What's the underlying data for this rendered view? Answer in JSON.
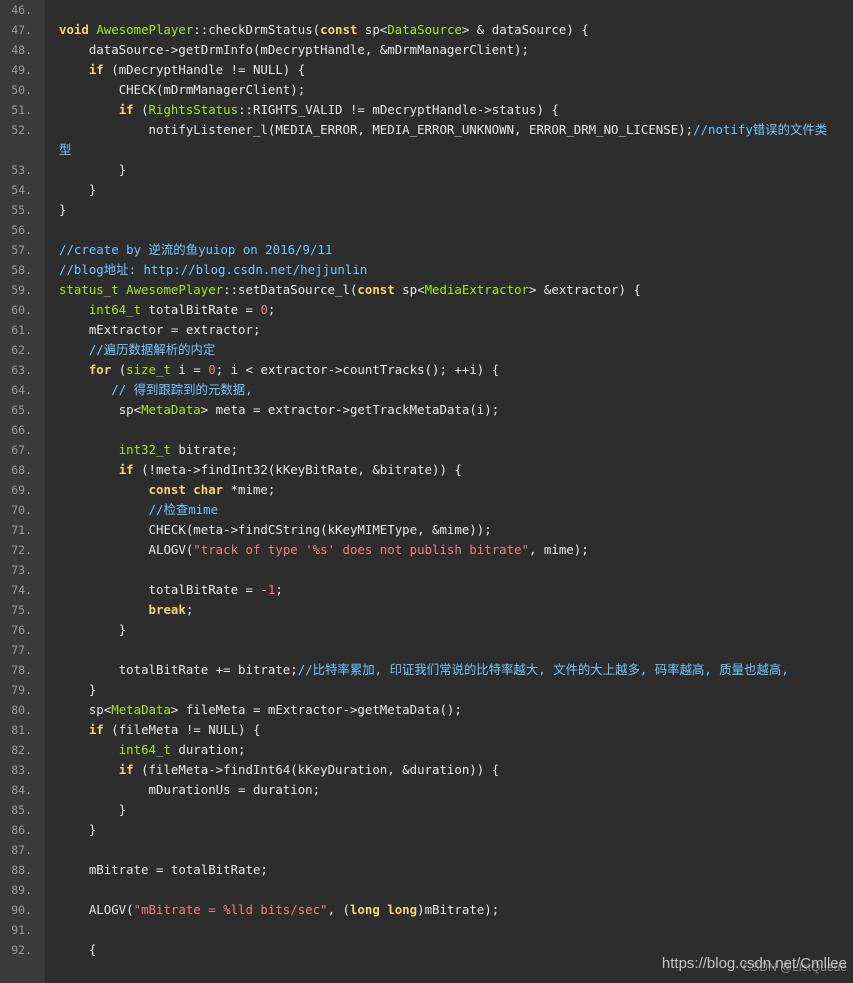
{
  "lines": [
    {
      "num": "46.",
      "tokens": []
    },
    {
      "num": "47.",
      "tokens": [
        [
          "k",
          "void "
        ],
        [
          "t",
          "AwesomePlayer"
        ],
        [
          "p",
          "::checkDrmStatus("
        ],
        [
          "k",
          "const "
        ],
        [
          "p",
          "sp<"
        ],
        [
          "t",
          "DataSource"
        ],
        [
          "p",
          "> & dataSource) {"
        ]
      ]
    },
    {
      "num": "48.",
      "tokens": [
        [
          "p",
          "    dataSource->getDrmInfo(mDecryptHandle, &mDrmManagerClient);"
        ]
      ]
    },
    {
      "num": "49.",
      "tokens": [
        [
          "p",
          "    "
        ],
        [
          "k",
          "if "
        ],
        [
          "p",
          "(mDecryptHandle != NULL) {"
        ]
      ]
    },
    {
      "num": "50.",
      "tokens": [
        [
          "p",
          "        CHECK(mDrmManagerClient);"
        ]
      ]
    },
    {
      "num": "51.",
      "tokens": [
        [
          "p",
          "        "
        ],
        [
          "k",
          "if "
        ],
        [
          "p",
          "("
        ],
        [
          "t",
          "RightsStatus"
        ],
        [
          "p",
          "::RIGHTS_VALID != mDecryptHandle->status) {"
        ]
      ]
    },
    {
      "num": "52.",
      "tokens": [
        [
          "p",
          "            notifyListener_l(MEDIA_ERROR, MEDIA_ERROR_UNKNOWN, ERROR_DRM_NO_LICENSE);"
        ],
        [
          "c",
          "//notify错误的文件类型"
        ]
      ]
    },
    {
      "num": "53.",
      "tokens": [
        [
          "p",
          "        }"
        ]
      ]
    },
    {
      "num": "54.",
      "tokens": [
        [
          "p",
          "    }"
        ]
      ]
    },
    {
      "num": "55.",
      "tokens": [
        [
          "p",
          "}"
        ]
      ]
    },
    {
      "num": "56.",
      "tokens": []
    },
    {
      "num": "57.",
      "tokens": [
        [
          "c",
          "//create by 逆流的鱼yuiop on 2016/9/11"
        ]
      ]
    },
    {
      "num": "58.",
      "tokens": [
        [
          "c",
          "//blog地址: http://blog.csdn.net/hejjunlin"
        ]
      ]
    },
    {
      "num": "59.",
      "tokens": [
        [
          "t",
          "status_t "
        ],
        [
          "t",
          "AwesomePlayer"
        ],
        [
          "p",
          "::setDataSource_l("
        ],
        [
          "k",
          "const "
        ],
        [
          "p",
          "sp<"
        ],
        [
          "t",
          "MediaExtractor"
        ],
        [
          "p",
          "> &extractor) {"
        ]
      ]
    },
    {
      "num": "60.",
      "tokens": [
        [
          "p",
          "    "
        ],
        [
          "t",
          "int64_t "
        ],
        [
          "p",
          "totalBitRate = "
        ],
        [
          "n",
          "0"
        ],
        [
          "p",
          ";"
        ]
      ]
    },
    {
      "num": "61.",
      "tokens": [
        [
          "p",
          "    mExtractor = extractor;"
        ]
      ]
    },
    {
      "num": "62.",
      "tokens": [
        [
          "p",
          "    "
        ],
        [
          "c",
          "//遍历数据解析的内定"
        ]
      ]
    },
    {
      "num": "63.",
      "tokens": [
        [
          "p",
          "    "
        ],
        [
          "k",
          "for "
        ],
        [
          "p",
          "("
        ],
        [
          "t",
          "size_t "
        ],
        [
          "p",
          "i = "
        ],
        [
          "n",
          "0"
        ],
        [
          "p",
          "; i < extractor->countTracks(); ++i) {"
        ]
      ]
    },
    {
      "num": "64.",
      "tokens": [
        [
          "p",
          "       "
        ],
        [
          "c",
          "// 得到跟踪到的元数据,"
        ]
      ]
    },
    {
      "num": "65.",
      "tokens": [
        [
          "p",
          "        sp<"
        ],
        [
          "t",
          "MetaData"
        ],
        [
          "p",
          "> meta = extractor->getTrackMetaData(i);"
        ]
      ]
    },
    {
      "num": "66.",
      "tokens": []
    },
    {
      "num": "67.",
      "tokens": [
        [
          "p",
          "        "
        ],
        [
          "t",
          "int32_t "
        ],
        [
          "p",
          "bitrate;"
        ]
      ]
    },
    {
      "num": "68.",
      "tokens": [
        [
          "p",
          "        "
        ],
        [
          "k",
          "if "
        ],
        [
          "p",
          "(!meta->findInt32(kKeyBitRate, &bitrate)) {"
        ]
      ]
    },
    {
      "num": "69.",
      "tokens": [
        [
          "p",
          "            "
        ],
        [
          "k",
          "const char "
        ],
        [
          "p",
          "*mime;"
        ]
      ]
    },
    {
      "num": "70.",
      "tokens": [
        [
          "p",
          "            "
        ],
        [
          "c",
          "//检查mime"
        ]
      ]
    },
    {
      "num": "71.",
      "tokens": [
        [
          "p",
          "            CHECK(meta->findCString(kKeyMIMEType, &mime));"
        ]
      ]
    },
    {
      "num": "72.",
      "tokens": [
        [
          "p",
          "            ALOGV("
        ],
        [
          "s",
          "\"track of type '%s' does not publish bitrate\""
        ],
        [
          "p",
          ", mime);"
        ]
      ]
    },
    {
      "num": "73.",
      "tokens": []
    },
    {
      "num": "74.",
      "tokens": [
        [
          "p",
          "            totalBitRate = -"
        ],
        [
          "n",
          "1"
        ],
        [
          "p",
          ";"
        ]
      ]
    },
    {
      "num": "75.",
      "tokens": [
        [
          "p",
          "            "
        ],
        [
          "k",
          "break"
        ],
        [
          "p",
          ";"
        ]
      ]
    },
    {
      "num": "76.",
      "tokens": [
        [
          "p",
          "        }"
        ]
      ]
    },
    {
      "num": "77.",
      "tokens": []
    },
    {
      "num": "78.",
      "tokens": [
        [
          "p",
          "        totalBitRate += bitrate;"
        ],
        [
          "c",
          "//比特率累加, 印证我们常说的比特率越大, 文件的大上越多, 码率越高, 质量也越高,"
        ]
      ]
    },
    {
      "num": "79.",
      "tokens": [
        [
          "p",
          "    }"
        ]
      ]
    },
    {
      "num": "80.",
      "tokens": [
        [
          "p",
          "    sp<"
        ],
        [
          "t",
          "MetaData"
        ],
        [
          "p",
          "> fileMeta = mExtractor->getMetaData();"
        ]
      ]
    },
    {
      "num": "81.",
      "tokens": [
        [
          "p",
          "    "
        ],
        [
          "k",
          "if "
        ],
        [
          "p",
          "(fileMeta != NULL) {"
        ]
      ]
    },
    {
      "num": "82.",
      "tokens": [
        [
          "p",
          "        "
        ],
        [
          "t",
          "int64_t "
        ],
        [
          "p",
          "duration;"
        ]
      ]
    },
    {
      "num": "83.",
      "tokens": [
        [
          "p",
          "        "
        ],
        [
          "k",
          "if "
        ],
        [
          "p",
          "(fileMeta->findInt64(kKeyDuration, &duration)) {"
        ]
      ]
    },
    {
      "num": "84.",
      "tokens": [
        [
          "p",
          "            mDurationUs = duration;"
        ]
      ]
    },
    {
      "num": "85.",
      "tokens": [
        [
          "p",
          "        }"
        ]
      ]
    },
    {
      "num": "86.",
      "tokens": [
        [
          "p",
          "    }"
        ]
      ]
    },
    {
      "num": "87.",
      "tokens": []
    },
    {
      "num": "88.",
      "tokens": [
        [
          "p",
          "    mBitrate = totalBitRate;"
        ]
      ]
    },
    {
      "num": "89.",
      "tokens": []
    },
    {
      "num": "90.",
      "tokens": [
        [
          "p",
          "    ALOGV("
        ],
        [
          "s",
          "\"mBitrate = %lld bits/sec\""
        ],
        [
          "p",
          ", ("
        ],
        [
          "k",
          "long long"
        ],
        [
          "p",
          ")mBitrate);"
        ]
      ]
    },
    {
      "num": "91.",
      "tokens": []
    },
    {
      "num": "92.",
      "tokens": [
        [
          "p",
          "    {"
        ]
      ]
    }
  ],
  "watermark": "https://blog.csdn.net/Cmllee",
  "watermark_overlay": "CSDN @ListQueue",
  "colors": {
    "background": "#2d2d2d",
    "gutter": "#3a3a3a",
    "keyword": "#f5d276",
    "type": "#a6e22e",
    "string": "#f47a7a",
    "comment": "#6fc4ff"
  }
}
